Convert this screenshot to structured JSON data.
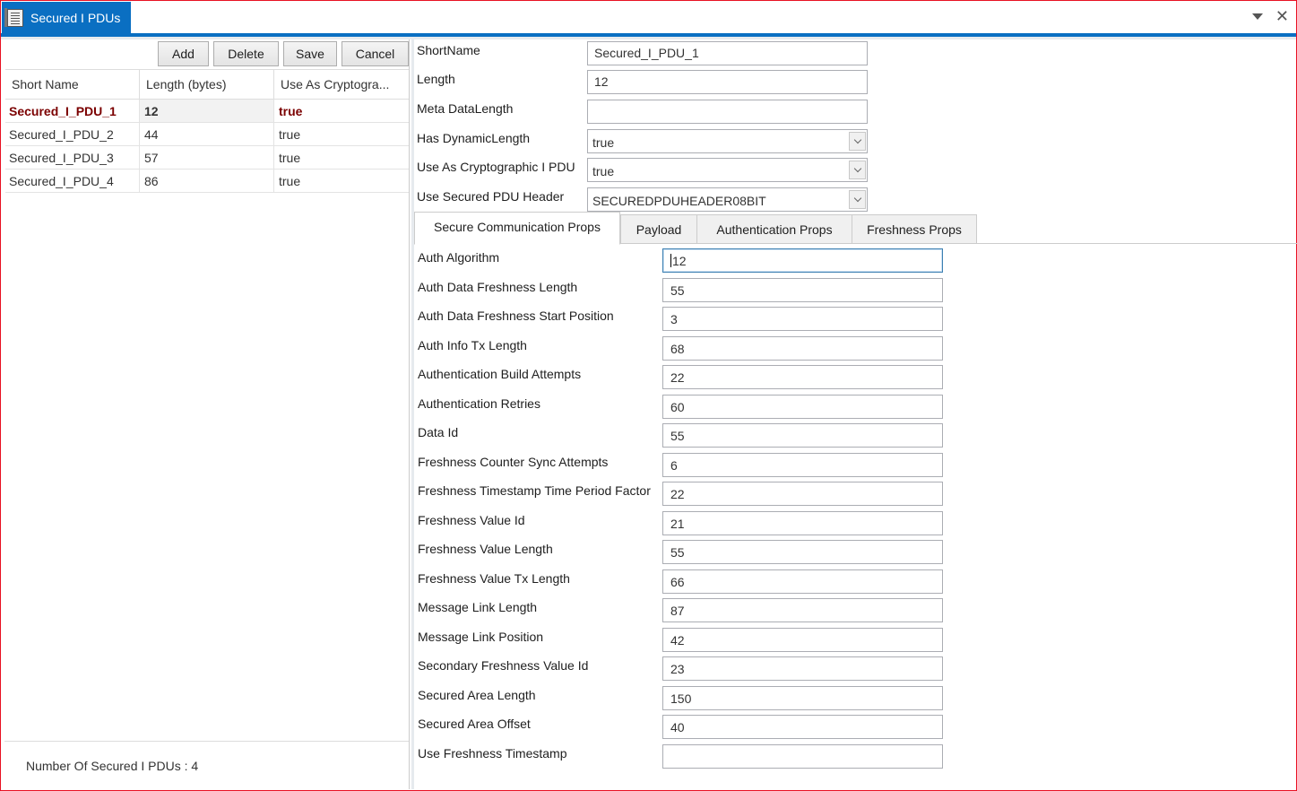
{
  "window": {
    "title": "Secured I PDUs",
    "title_icon": "document-icon",
    "controls": [
      "dropdown-arrow-icon",
      "close-icon"
    ],
    "close_glyph": "✕",
    "accent_color": "#0a6fc2",
    "border_color": "#e81123"
  },
  "toolbar": {
    "add_label": "Add",
    "delete_label": "Delete",
    "save_label": "Save",
    "cancel_label": "Cancel"
  },
  "grid": {
    "columns": [
      "Short Name",
      "Length (bytes)",
      "Use As Cryptogra..."
    ],
    "rows": [
      {
        "short_name": "Secured_I_PDU_1",
        "length": "12",
        "use_as_crypto": "true",
        "selected": true
      },
      {
        "short_name": "Secured_I_PDU_2",
        "length": "44",
        "use_as_crypto": "true",
        "selected": false
      },
      {
        "short_name": "Secured_I_PDU_3",
        "length": "57",
        "use_as_crypto": "true",
        "selected": false
      },
      {
        "short_name": "Secured_I_PDU_4",
        "length": "86",
        "use_as_crypto": "true",
        "selected": false
      }
    ],
    "selected_color": "#7b0000"
  },
  "footer": {
    "count_text": "Number Of Secured I PDUs : 4"
  },
  "details": {
    "short_name": {
      "label": "ShortName",
      "value": "Secured_I_PDU_1"
    },
    "length": {
      "label": "Length",
      "value": "12"
    },
    "meta_data_length": {
      "label": "Meta DataLength",
      "value": ""
    },
    "has_dynamic_length": {
      "label": "Has DynamicLength",
      "value": "true"
    },
    "use_as_cryptographic": {
      "label": "Use As Cryptographic I PDU",
      "value": "true"
    },
    "use_secured_pdu_header": {
      "label": "Use Secured PDU Header",
      "value": "SECUREDPDUHEADER08BIT"
    }
  },
  "tabs": [
    {
      "label": "Secure Communication Props",
      "active": true
    },
    {
      "label": "Payload",
      "active": false
    },
    {
      "label": "Authentication Props",
      "active": false
    },
    {
      "label": "Freshness Props",
      "active": false
    }
  ],
  "secure_comm_props": [
    {
      "label": "Auth Algorithm",
      "value": "12",
      "focused": true
    },
    {
      "label": "Auth Data Freshness Length",
      "value": "55"
    },
    {
      "label": "Auth Data Freshness Start Position",
      "value": "3"
    },
    {
      "label": "Auth Info Tx Length",
      "value": "68"
    },
    {
      "label": "Authentication Build Attempts",
      "value": "22"
    },
    {
      "label": "Authentication Retries",
      "value": "60"
    },
    {
      "label": "Data Id",
      "value": "55"
    },
    {
      "label": "Freshness Counter Sync Attempts",
      "value": "6"
    },
    {
      "label": "Freshness Timestamp Time Period Factor",
      "value": "22"
    },
    {
      "label": "Freshness Value Id",
      "value": "21"
    },
    {
      "label": "Freshness Value Length",
      "value": "55"
    },
    {
      "label": "Freshness Value Tx Length",
      "value": "66"
    },
    {
      "label": "Message Link Length",
      "value": "87"
    },
    {
      "label": "Message Link Position",
      "value": "42"
    },
    {
      "label": "Secondary Freshness Value Id",
      "value": "23"
    },
    {
      "label": "Secured Area Length",
      "value": "150"
    },
    {
      "label": "Secured Area Offset",
      "value": "40"
    },
    {
      "label": "Use Freshness Timestamp",
      "value": ""
    }
  ]
}
